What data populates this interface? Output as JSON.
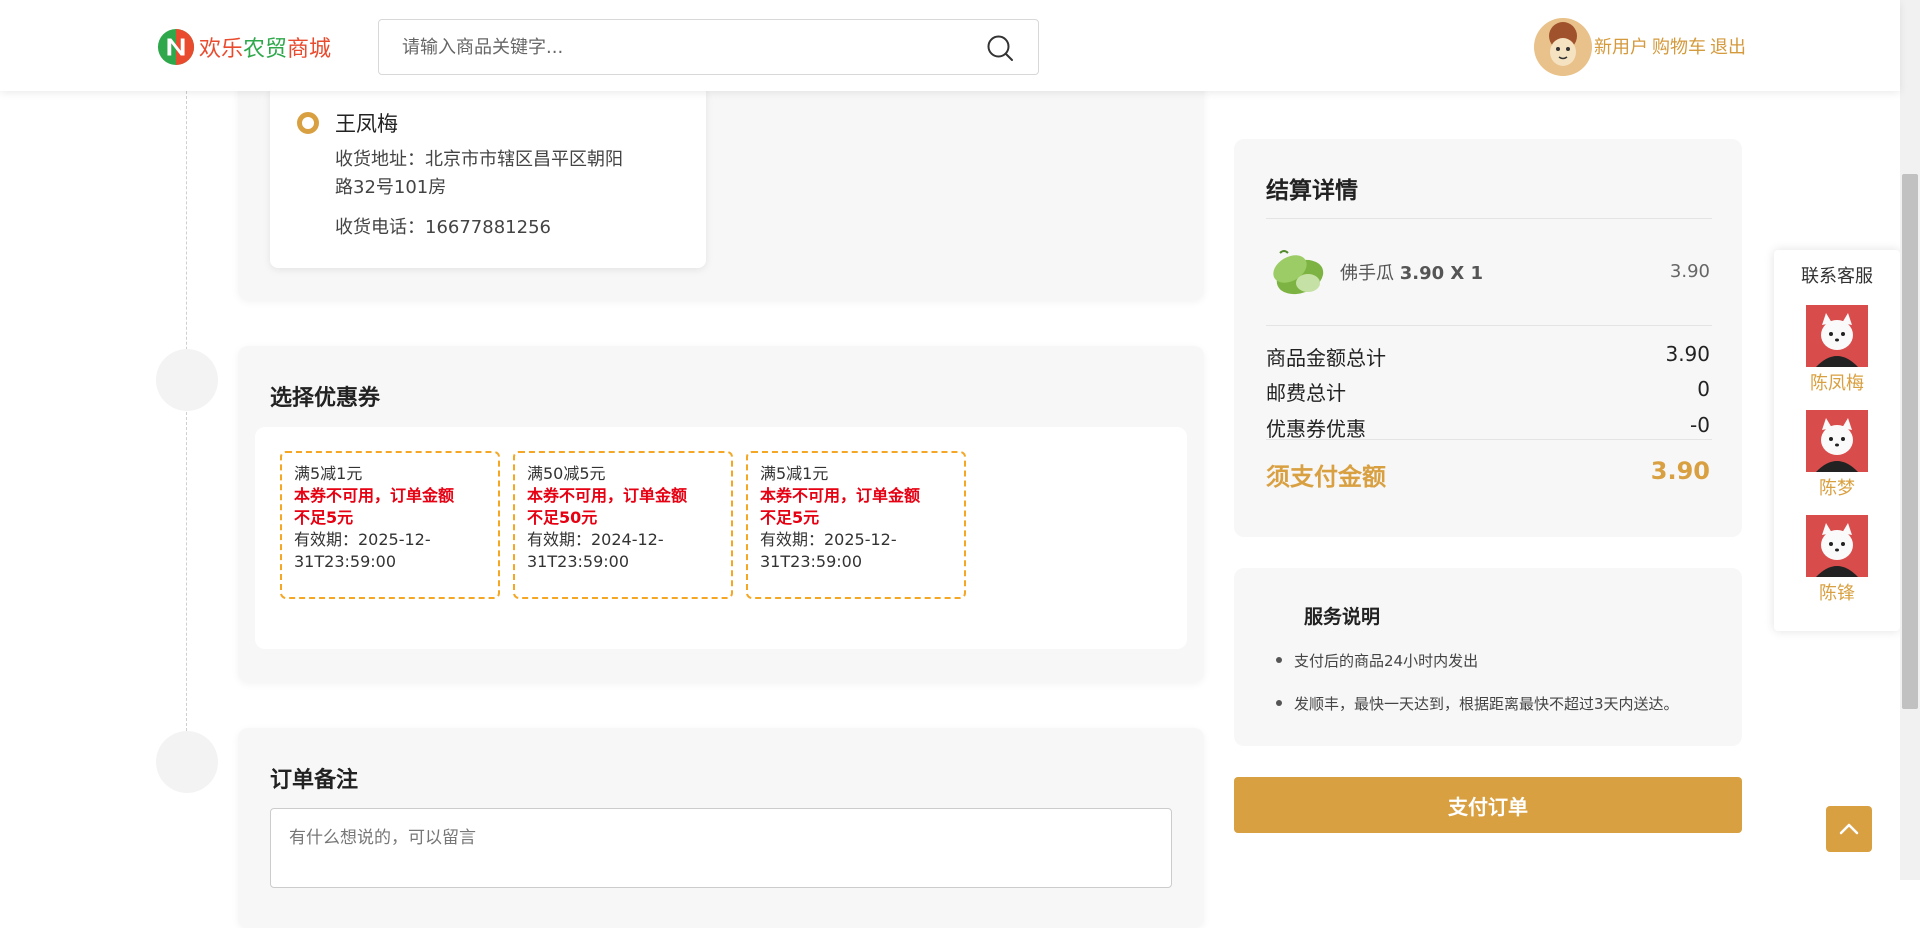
{
  "header": {
    "logo_text_1": "欢乐",
    "logo_text_2": "农贸",
    "logo_text_3": "商城",
    "search_placeholder": "请输入商品关键字...",
    "user_name": "新用户",
    "cart_link": "购物车",
    "logout_link": "退出"
  },
  "address": {
    "name": "王凤梅",
    "address_line1": "收货地址：北京市市辖区昌平区朝阳",
    "address_line2": "路32号101房",
    "phone_line": "收货电话：16677881256"
  },
  "coupons": {
    "title": "选择优惠券",
    "items": [
      {
        "name": "满5减1元",
        "error1": "本券不可用，订单金额",
        "error2": "不足5元",
        "exp1": "有效期：2025-12-",
        "exp2": "31T23:59:00"
      },
      {
        "name": "满50减5元",
        "error1": "本券不可用，订单金额",
        "error2": "不足50元",
        "exp1": "有效期：2024-12-",
        "exp2": "31T23:59:00"
      },
      {
        "name": "满5减1元",
        "error1": "本券不可用，订单金额",
        "error2": "不足5元",
        "exp1": "有效期：2025-12-",
        "exp2": "31T23:59:00"
      }
    ]
  },
  "note": {
    "title": "订单备注",
    "placeholder": "有什么想说的，可以留言"
  },
  "summary": {
    "title": "结算详情",
    "product_name": "佛手瓜",
    "product_qty": "3.90 X 1",
    "product_price": "3.90",
    "goods_total_label": "商品金额总计",
    "goods_total_value": "3.90",
    "shipping_label": "邮费总计",
    "shipping_value": "0",
    "coupon_label": "优惠券优惠",
    "coupon_value": "-0",
    "pay_label": "须支付金额",
    "pay_value": "3.90"
  },
  "service": {
    "title": "服务说明",
    "items": [
      "支付后的商品24小时内发出",
      "发顺丰，最快一天达到，根据距离最快不超过3天内送达。"
    ]
  },
  "pay_button": "支付订单",
  "customer_service": {
    "title": "联系客服",
    "agents": [
      "陈凤梅",
      "陈梦",
      "陈锋"
    ]
  },
  "colors": {
    "accent": "#d9a041",
    "error": "#e60012",
    "coupon_border": "#f5a623"
  }
}
